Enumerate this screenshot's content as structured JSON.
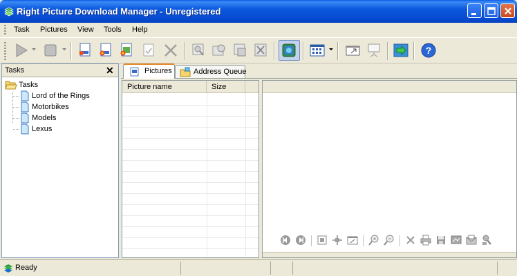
{
  "window": {
    "title": "Right Picture Download Manager - Unregistered",
    "app_icon": "stack-icon"
  },
  "menu": {
    "items": [
      "Task",
      "Pictures",
      "View",
      "Tools",
      "Help"
    ]
  },
  "toolbar": {
    "buttons": [
      "play",
      "stop",
      "new-task",
      "new-task-star",
      "new-task-pictures",
      "check-task",
      "delete",
      "find-pictures",
      "refresh-pictures",
      "download-pictures",
      "cancel-download",
      "browser",
      "thumbnails-view",
      "window",
      "slideshow",
      "export",
      "help"
    ]
  },
  "tasks_panel": {
    "header": "Tasks",
    "close_glyph": "✕",
    "root_label": "Tasks",
    "items": [
      "Lord of the Rings",
      "Motorbikes",
      "Models",
      "Lexus"
    ]
  },
  "tabs": [
    {
      "label": "Pictures",
      "active": true
    },
    {
      "label": "Address Queue",
      "active": false
    }
  ],
  "list": {
    "columns": [
      "Picture name",
      "Size"
    ]
  },
  "status": {
    "text": "Ready"
  },
  "colors": {
    "titlebar": "#0b58dd",
    "folder": "#f5d46b",
    "accent_tab": "#e68b2c"
  }
}
